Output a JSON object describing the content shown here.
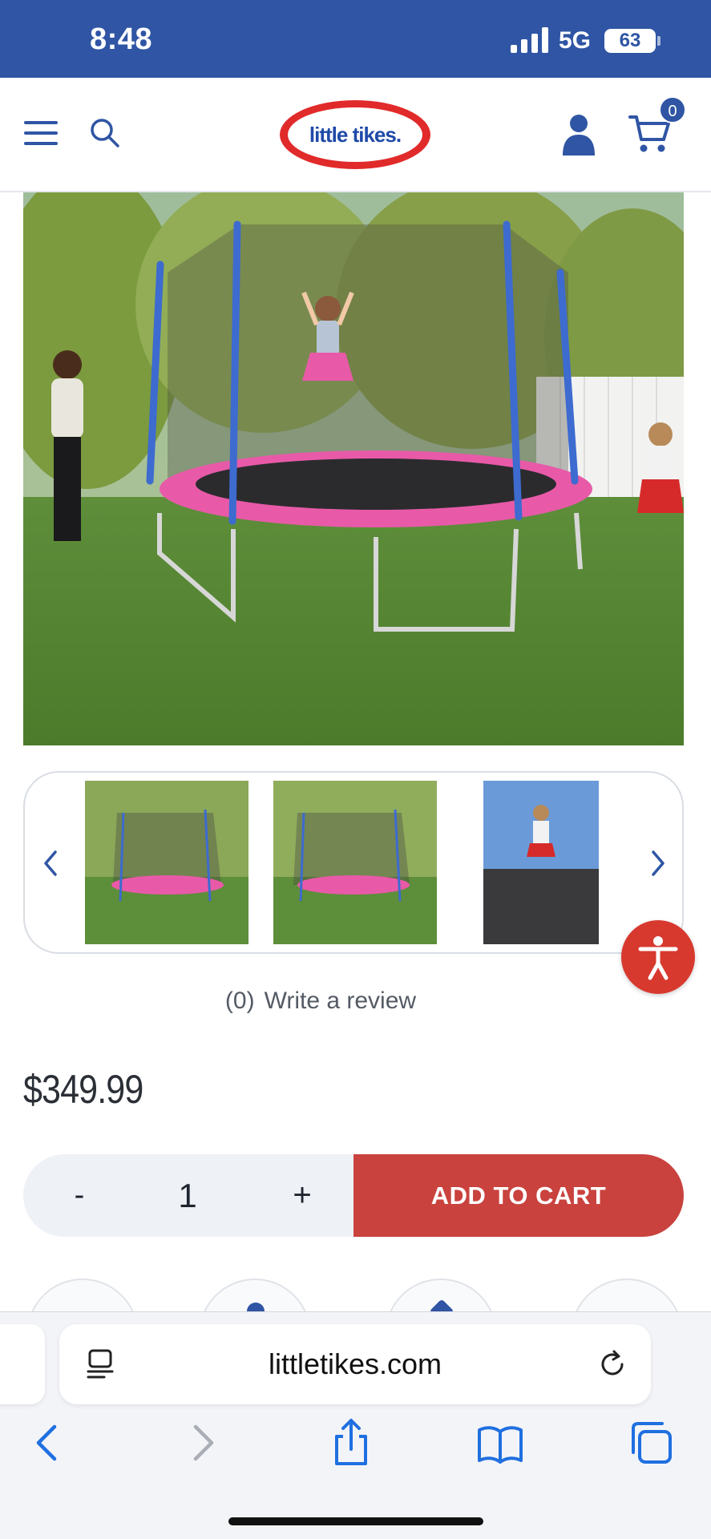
{
  "status_bar": {
    "time": "8:48",
    "network": "5G",
    "battery": "63"
  },
  "header": {
    "logo_text": "little tikes.",
    "cart_count": "0"
  },
  "review": {
    "count": "(0)",
    "link": "Write a review"
  },
  "product": {
    "price": "$349.99",
    "quantity": "1",
    "minus_label": "-",
    "plus_label": "+",
    "add_to_cart_label": "ADD TO CART"
  },
  "browser": {
    "url": "littletikes.com"
  },
  "colors": {
    "brand_blue": "#2f55a4",
    "cart_red": "#c9423e",
    "logo_red": "#e12a2a"
  }
}
